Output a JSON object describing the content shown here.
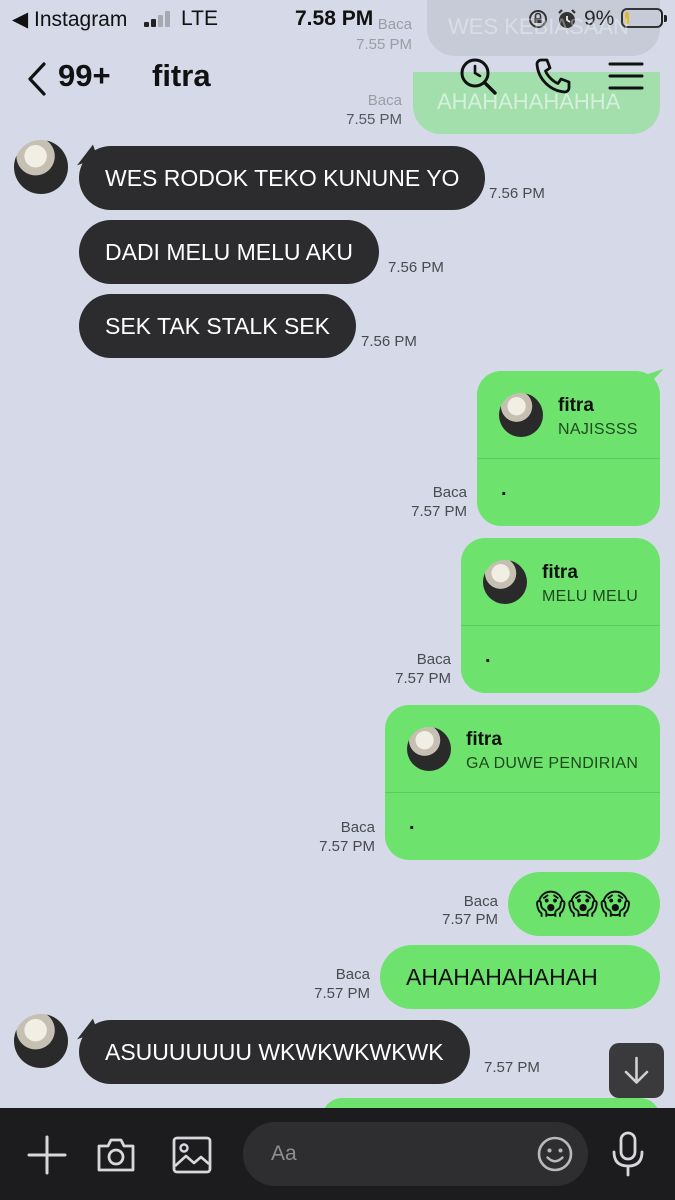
{
  "status_bar": {
    "back_app": "◀ Instagram",
    "network": "LTE",
    "time": "7.58 PM",
    "battery": "9%",
    "battery_level": 0.09
  },
  "header": {
    "unread_count": "99+",
    "title": "fitra"
  },
  "ghost": {
    "msg1_text": "WES KEBIASAAN",
    "msg1_read": "Baca",
    "msg1_time": "7.55 PM",
    "msg2_text": "AHAHAHAHAHHA",
    "msg2_read": "Baca",
    "msg2_time": "7.55 PM"
  },
  "messages": [
    {
      "side": "in",
      "text": "WES RODOK TEKO KUNUNE YO",
      "time": "7.56 PM"
    },
    {
      "side": "in",
      "text": "DADI MELU MELU AKU",
      "time": "7.56 PM"
    },
    {
      "side": "in",
      "text": "SEK TAK STALK SEK",
      "time": "7.56 PM"
    },
    {
      "side": "out",
      "reply_name": "fitra",
      "reply_text": "NAJISSSS",
      "text": ".",
      "read": "Baca",
      "time": "7.57 PM"
    },
    {
      "side": "out",
      "reply_name": "fitra",
      "reply_text": "MELU MELU",
      "text": ".",
      "read": "Baca",
      "time": "7.57 PM"
    },
    {
      "side": "out",
      "reply_name": "fitra",
      "reply_text": "GA DUWE PENDIRIAN",
      "text": ".",
      "read": "Baca",
      "time": "7.57 PM"
    },
    {
      "side": "out",
      "text": "😱😱😱",
      "read": "Baca",
      "time": "7.57 PM"
    },
    {
      "side": "out",
      "text": "AHAHAHAHAHAH",
      "read": "Baca",
      "time": "7.57 PM"
    },
    {
      "side": "in",
      "text": "ASUUUUUUU WKWKWKWKWK",
      "time": "7.57 PM"
    }
  ],
  "composer": {
    "placeholder": "Aa"
  },
  "colors": {
    "background": "#d5d9e8",
    "outgoing_bubble": "#6de36d",
    "incoming_bubble": "#2c2c2e",
    "composer_bar": "#1c1c1e"
  }
}
